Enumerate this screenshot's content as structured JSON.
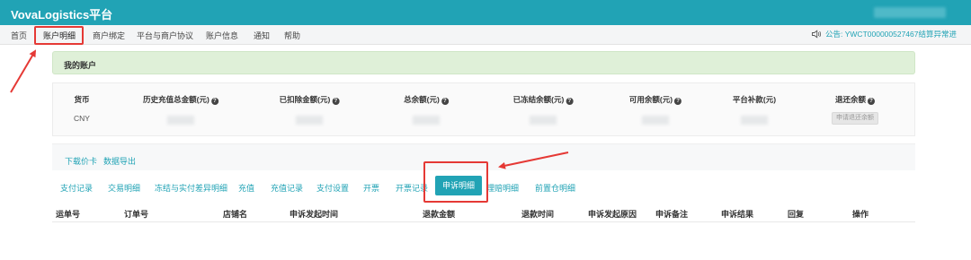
{
  "app": {
    "title": "VovaLogistics平台"
  },
  "nav": {
    "items": [
      "首页",
      "账户明细",
      "商户绑定",
      "平台与商户协议",
      "账户信息",
      "通知",
      "帮助"
    ],
    "active_index": 1
  },
  "notice": {
    "text": "公告: YWCT000000527467结算异常进"
  },
  "account": {
    "banner_title": "我的账户",
    "headers": [
      "货币",
      "历史充值总金额(元)",
      "已扣除金额(元)",
      "总余额(元)",
      "已冻结余额(元)",
      "可用余额(元)",
      "平台补款(元)",
      "退还余额"
    ],
    "currency": "CNY",
    "refund_button": "申请退还余额"
  },
  "links": [
    "下载价卡",
    "数据导出"
  ],
  "tabs": {
    "items": [
      "支付记录",
      "交易明细",
      "冻结与实付差异明细",
      "充值",
      "充值记录",
      "支付设置",
      "开票",
      "开票记录",
      "申诉明细",
      "理赔明细",
      "前置仓明细"
    ],
    "active_index": 8
  },
  "table": {
    "columns": [
      "运单号",
      "订单号",
      "店铺名",
      "申诉发起时间",
      "退款金额",
      "退款时间",
      "申诉发起原因",
      "申诉备注",
      "申诉结果",
      "回复",
      "操作"
    ]
  },
  "colors": {
    "brand": "#21a3b5",
    "annotation": "#e53935",
    "banner_bg": "#dff0d8"
  },
  "icons": {
    "notice": "speaker-icon",
    "help": "question-circle-icon"
  }
}
